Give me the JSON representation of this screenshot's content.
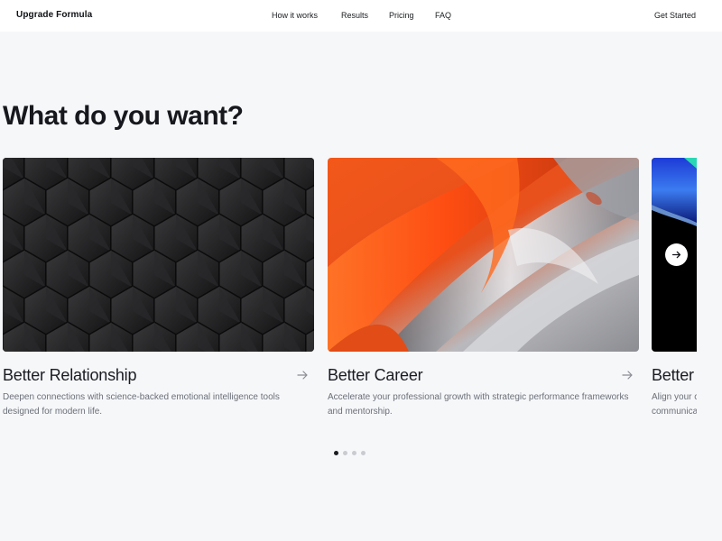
{
  "header": {
    "brand": "Upgrade Formula",
    "nav": [
      "How it works",
      "Results",
      "Pricing",
      "FAQ"
    ],
    "cta": "Get Started"
  },
  "hero": {
    "headline": "What do you want?"
  },
  "cards": [
    {
      "title": "Better Relationship",
      "description": "Deepen connections with science-backed emotional intelligence tools designed for modern life.",
      "image": "black-polyhedra-pattern"
    },
    {
      "title": "Better Career",
      "description": "Accelerate your professional growth with strategic performance frameworks and mentorship.",
      "image": "orange-silver-fluid-abstract"
    },
    {
      "title": "Better",
      "description_lines": [
        "Align your c",
        "communica"
      ],
      "image": "blue-green-wave-abstract"
    }
  ],
  "carousel": {
    "pages": 4,
    "active_index": 0,
    "next_icon": "arrow-right-icon"
  },
  "colors": {
    "background": "#f6f7f9",
    "header": "#ffffff",
    "text": "#111318",
    "muted": "#6b6f78",
    "accent_orange": "#f05a1a"
  }
}
